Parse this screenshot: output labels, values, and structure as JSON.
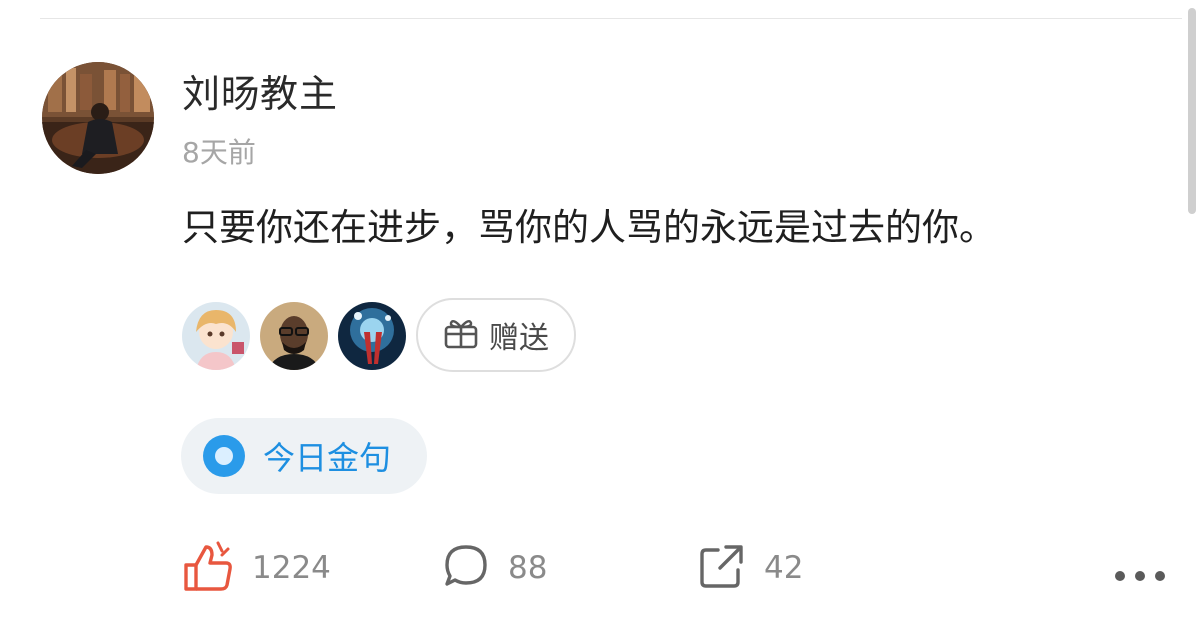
{
  "post": {
    "author": "刘旸教主",
    "time": "8天前",
    "text": "只要你还在进步，骂你的人骂的永远是过去的你。"
  },
  "gifts": {
    "button_label": "赠送",
    "gifters": [
      "gifter-1",
      "gifter-2",
      "gifter-3"
    ]
  },
  "topic": {
    "label": "今日金句"
  },
  "actions": {
    "likes": "1224",
    "comments": "88",
    "shares": "42"
  },
  "icons": {
    "like": "thumbs-up-icon",
    "comment": "comment-bubble-icon",
    "share": "share-icon",
    "gift": "gift-icon",
    "more": "more-dots-icon"
  },
  "colors": {
    "accent": "#2a9bea",
    "like": "#e8573f",
    "muted": "#a6a6a6",
    "chip_bg": "#eef2f5"
  }
}
